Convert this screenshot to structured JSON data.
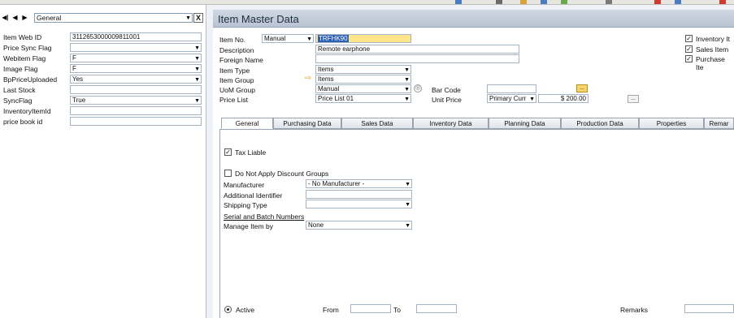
{
  "left_panel": {
    "nav_select": "General",
    "close_label": "X",
    "fields": [
      {
        "label": "Item Web ID",
        "value": "3112653000009811001",
        "dropdown": false
      },
      {
        "label": "Price Sync Flag",
        "value": "",
        "dropdown": true
      },
      {
        "label": "Webitem Flag",
        "value": "F",
        "dropdown": true
      },
      {
        "label": "Image Flag",
        "value": "F",
        "dropdown": true
      },
      {
        "label": "BpPriceUploaded",
        "value": "Yes",
        "dropdown": true
      },
      {
        "label": "Last Stock",
        "value": "",
        "dropdown": false
      },
      {
        "label": "SyncFlag",
        "value": "True",
        "dropdown": true
      },
      {
        "label": "InventoryItemId",
        "value": "",
        "dropdown": false
      },
      {
        "label": "price  book id",
        "value": "",
        "dropdown": false
      }
    ]
  },
  "window": {
    "title": "Item Master Data"
  },
  "header_fields": {
    "item_no_label": "Item No.",
    "item_no_mode": "Manual",
    "item_no_value": "TRFHK90",
    "description_label": "Description",
    "description_value": "Remote earphone",
    "foreign_name_label": "Foreign Name",
    "foreign_name_value": "",
    "item_type_label": "Item Type",
    "item_type_value": "Items",
    "item_group_label": "Item Group",
    "item_group_value": "Items",
    "uom_group_label": "UoM Group",
    "uom_group_value": "Manual",
    "price_list_label": "Price List",
    "price_list_value": "Price List 01",
    "bar_code_label": "Bar Code",
    "bar_code_value": "",
    "unit_price_label": "Unit Price",
    "unit_price_currency": "Primary Curr",
    "unit_price_value": "$ 200.00"
  },
  "checkboxes_right": [
    {
      "label": "Inventory It",
      "checked": true
    },
    {
      "label": "Sales Item",
      "checked": true
    },
    {
      "label": "Purchase Ite",
      "checked": true
    }
  ],
  "tabs": [
    "General",
    "Purchasing Data",
    "Sales Data",
    "Inventory Data",
    "Planning Data",
    "Production Data",
    "Properties",
    "Remar"
  ],
  "general_tab": {
    "tax_liable_label": "Tax Liable",
    "tax_liable_checked": true,
    "no_discount_label": "Do Not Apply Discount Groups",
    "no_discount_checked": false,
    "manufacturer_label": "Manufacturer",
    "manufacturer_value": "- No Manufacturer -",
    "additional_identifier_label": "Additional Identifier",
    "additional_identifier_value": "",
    "shipping_type_label": "Shipping Type",
    "shipping_type_value": "",
    "serial_batch_label": "Serial and Batch Numbers",
    "manage_item_by_label": "Manage Item by",
    "manage_item_by_value": "None",
    "active_label": "Active",
    "from_label": "From",
    "to_label": "To",
    "remarks_label": "Remarks"
  }
}
